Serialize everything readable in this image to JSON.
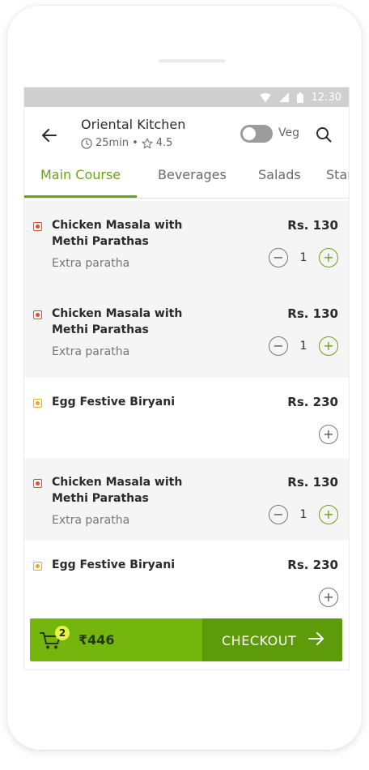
{
  "status_bar": {
    "time": "12:30",
    "icons": [
      "wifi-icon",
      "signal-icon",
      "battery-icon"
    ]
  },
  "header": {
    "title": "Oriental Kitchen",
    "time": "25min",
    "separator": "•",
    "rating": "4.5",
    "veg_label": "Veg",
    "veg_toggle_on": false
  },
  "tabs": [
    {
      "label": "Main Course",
      "active": true
    },
    {
      "label": "Beverages",
      "active": false
    },
    {
      "label": "Salads",
      "active": false
    },
    {
      "label": "Starters",
      "active": false
    }
  ],
  "items": [
    {
      "name": "Chicken Masala with Methi Parathas",
      "sub": "Extra paratha",
      "price": "Rs. 130",
      "qty": "1",
      "type": "nonveg"
    },
    {
      "name": "Chicken Masala with Methi Parathas",
      "sub": "Extra paratha",
      "price": "Rs. 130",
      "qty": "1",
      "type": "nonveg"
    },
    {
      "name": "Egg Festive Biryani",
      "sub": "",
      "price": "Rs. 230",
      "qty": "",
      "type": "egg"
    },
    {
      "name": "Chicken Masala with Methi Parathas",
      "sub": "Extra paratha",
      "price": "Rs. 130",
      "qty": "1",
      "type": "nonveg"
    },
    {
      "name": "Egg Festive Biryani",
      "sub": "",
      "price": "Rs. 230",
      "qty": "",
      "type": "egg"
    }
  ],
  "cart": {
    "count": "2",
    "total": "₹446",
    "checkout_label": "CHECKOUT"
  },
  "colors": {
    "accent": "#6aa318",
    "nonveg": "#d9541e",
    "egg": "#f5a623",
    "cart_left": "#75b60e",
    "cart_right": "#5e9b0a"
  }
}
